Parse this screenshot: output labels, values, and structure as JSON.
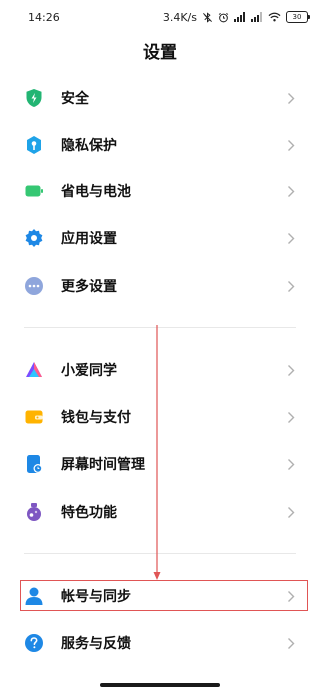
{
  "status_bar": {
    "time": "14:26",
    "network_speed": "3.4K/s",
    "battery": "30",
    "icons": [
      "bluetooth-off-icon",
      "alarm-icon",
      "signal-icon",
      "signal-icon",
      "wifi-icon",
      "battery-icon"
    ]
  },
  "header": {
    "title": "设置"
  },
  "group1": [
    {
      "label": "安全",
      "icon": "shield-icon",
      "color": "#22b573"
    },
    {
      "label": "隐私保护",
      "icon": "privacy-icon",
      "color": "#1fa3e8"
    },
    {
      "label": "省电与电池",
      "icon": "battery-saver-icon",
      "color": "#35c773"
    },
    {
      "label": "应用设置",
      "icon": "gear-icon",
      "color": "#1e88e5"
    },
    {
      "label": "更多设置",
      "icon": "more-icon",
      "color": "#7f9bd8"
    }
  ],
  "group2": [
    {
      "label": "小爱同学",
      "icon": "xiaoai-icon",
      "color": "#7c4dff"
    },
    {
      "label": "钱包与支付",
      "icon": "wallet-icon",
      "color": "#ffb300"
    },
    {
      "label": "屏幕时间管理",
      "icon": "screen-time-icon",
      "color": "#1e88e5"
    },
    {
      "label": "特色功能",
      "icon": "features-icon",
      "color": "#7e57c2"
    }
  ],
  "group3": [
    {
      "label": "帐号与同步",
      "icon": "account-icon",
      "color": "#1e88e5"
    },
    {
      "label": "服务与反馈",
      "icon": "help-icon",
      "color": "#1e88e5"
    }
  ],
  "colors": {
    "highlight": "#e05555",
    "chevron": "#b0b0b0",
    "divider": "#e8e8e8"
  }
}
